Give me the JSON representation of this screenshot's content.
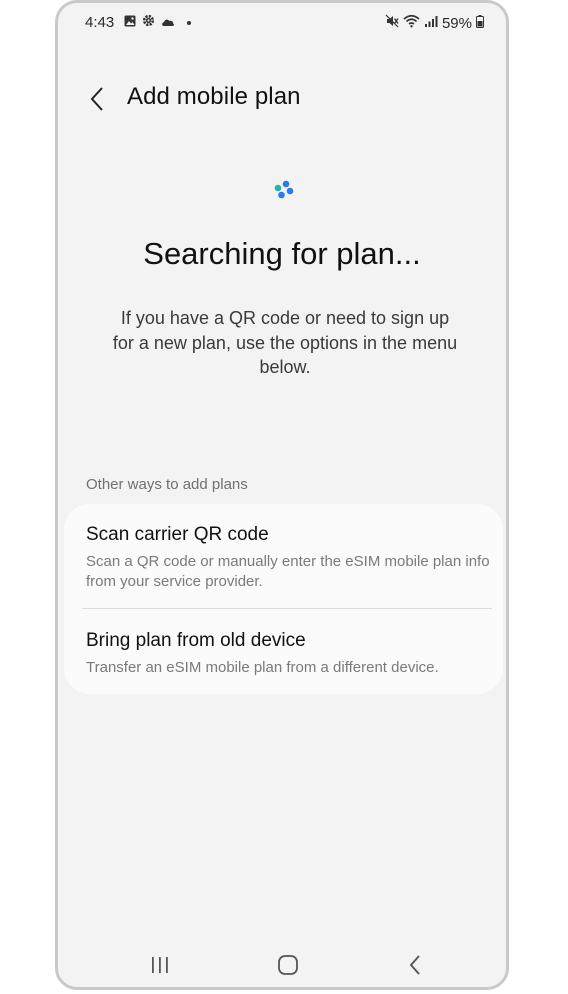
{
  "status_bar": {
    "time": "4:43",
    "left_icons": [
      "gallery-icon",
      "settings-gear-icon",
      "cloud-icon",
      "notification-dot-icon"
    ],
    "right_icons": [
      "mute-icon",
      "wifi-icon",
      "signal-icon",
      "battery-icon"
    ],
    "battery": "59%"
  },
  "header": {
    "title": "Add mobile plan"
  },
  "main": {
    "heading": "Searching for plan...",
    "description": "If you have a QR code or need to sign up for a new plan, use the options in the menu below."
  },
  "options": {
    "section_label": "Other ways to add plans",
    "items": [
      {
        "title": "Scan carrier QR code",
        "subtitle": "Scan a QR code or manually enter the eSIM mobile plan info from your service provider."
      },
      {
        "title": "Bring plan from old device",
        "subtitle": "Transfer an eSIM mobile plan from a different device."
      }
    ]
  },
  "nav_bar": {
    "buttons": [
      "recent-apps-icon",
      "home-icon",
      "back-icon"
    ]
  },
  "colors": {
    "screen_bg": "#f3f3f3",
    "card_bg": "#fbfbfb",
    "spinner_blue": "#2b7de9",
    "spinner_teal": "#1fb6a8"
  }
}
